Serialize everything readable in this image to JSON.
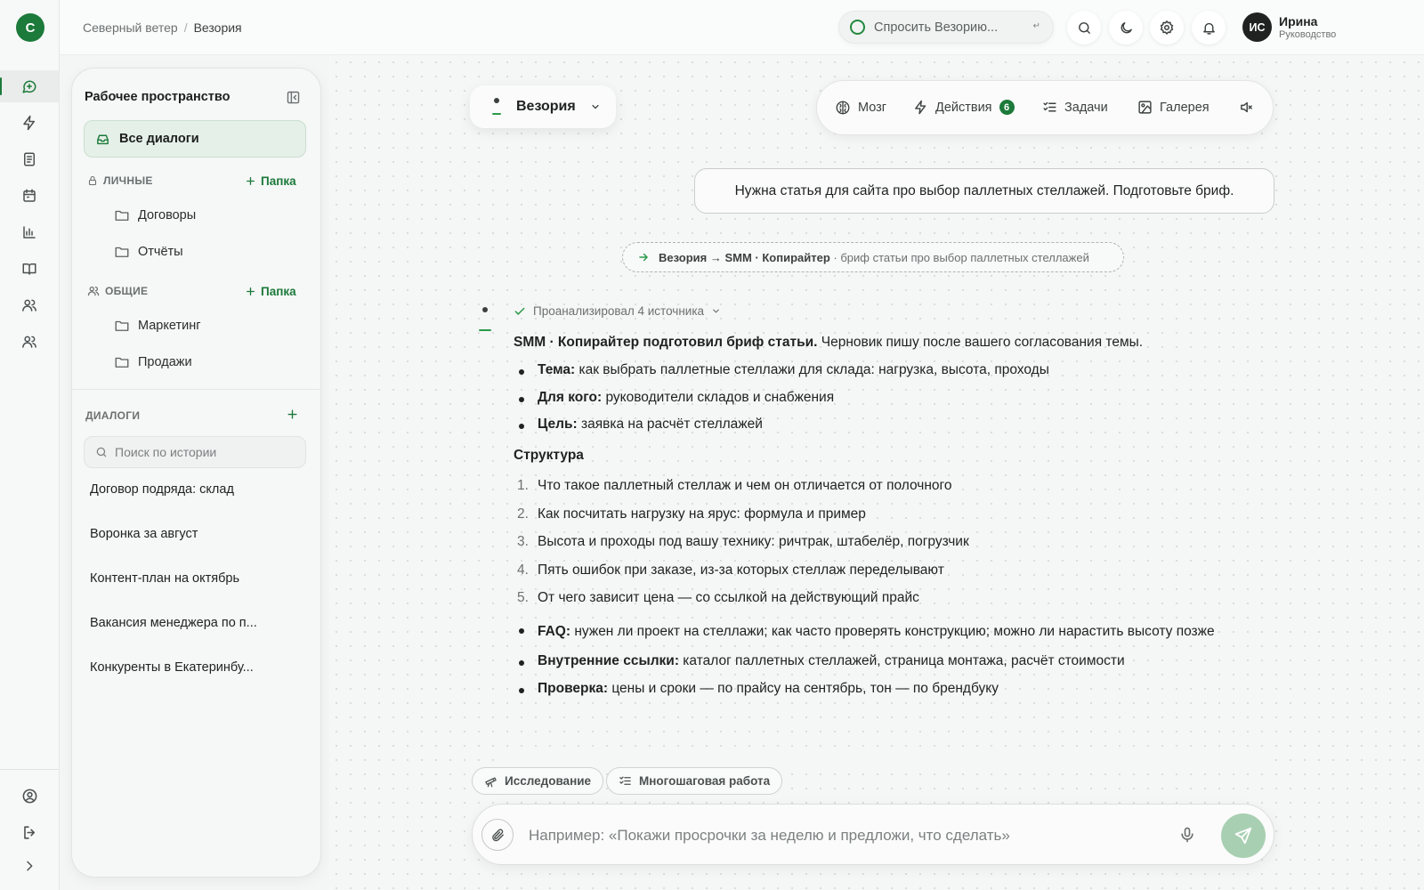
{
  "app": {
    "logo_letter": "С",
    "brand_color": "#1c7a3a"
  },
  "rail": {
    "items": [
      {
        "icon": "chat-icon"
      },
      {
        "icon": "lightning-icon"
      },
      {
        "icon": "document-icon"
      },
      {
        "icon": "calendar-icon"
      },
      {
        "icon": "chart-icon"
      },
      {
        "icon": "book-icon"
      },
      {
        "icon": "team-icon"
      },
      {
        "icon": "users-icon"
      }
    ],
    "bottom": [
      {
        "icon": "profile-icon"
      },
      {
        "icon": "logout-icon"
      },
      {
        "icon": "expand-icon"
      }
    ]
  },
  "topbar": {
    "breadcrumb": [
      "Северный ветер",
      "Везория"
    ],
    "breadcrumb_sep": "/",
    "ask_placeholder": "Спросить Везорию...",
    "ask_kbd": "↵",
    "user": {
      "initials": "ИС",
      "name": "Ирина",
      "role": "Руководство"
    }
  },
  "sidebar": {
    "title": "Рабочее пространство",
    "all_dialogs": "Все диалоги",
    "personal": {
      "label": "ЛИЧНЫЕ",
      "add": "Папка",
      "folders": [
        "Договоры",
        "Отчёты"
      ]
    },
    "shared": {
      "label": "ОБЩИЕ",
      "add": "Папка",
      "folders": [
        "Маркетинг",
        "Продажи"
      ]
    },
    "dialogs_label": "ДИАЛОГИ",
    "search_placeholder": "Поиск по истории",
    "history": [
      "Договор подряда: склад",
      "Воронка за август",
      "Контент-план на октябрь",
      "Вакансия менеджера по п...",
      "Конкуренты в Екатеринбу..."
    ]
  },
  "agent": {
    "name": "Везория"
  },
  "toolbar": {
    "brain": "Мозг",
    "actions": "Действия",
    "actions_count": "6",
    "tasks": "Задачи",
    "gallery": "Галерея"
  },
  "chat": {
    "user_message": "Нужна статья для сайта про выбор паллетных стеллажей. Подготовьте бриф.",
    "route": {
      "from": "Везория",
      "arrow": "→",
      "to": "SMM · Копирайтер",
      "note": "· бриф статьи про выбор паллетных стеллажей"
    },
    "analyzed": "Проанализировал 4 источника",
    "reply": {
      "intro_bold": "SMM · Копирайтер подготовил бриф статьи.",
      "intro_rest": " Черновик пишу после вашего согласования темы.",
      "meta": [
        {
          "label": "Тема:",
          "text": " как выбрать паллетные стеллажи для склада: нагрузка, высота, проходы"
        },
        {
          "label": "Для кого:",
          "text": " руководители складов и снабжения"
        },
        {
          "label": "Цель:",
          "text": " заявка на расчёт стеллажей"
        }
      ],
      "structure_title": "Структура",
      "structure": [
        {
          "n": "1.",
          "text": "Что такое паллетный стеллаж и чем он отличается от полочного"
        },
        {
          "n": "2.",
          "text": "Как посчитать нагрузку на ярус: формула и пример"
        },
        {
          "n": "3.",
          "text": "Высота и проходы под вашу технику: ричтрак, штабелёр, погрузчик"
        },
        {
          "n": "4.",
          "text": "Пять ошибок при заказе, из-за которых стеллаж переделывают"
        },
        {
          "n": "5.",
          "text": "От чего зависит цена — со ссылкой на действующий прайс"
        }
      ],
      "extra": [
        {
          "label": "FAQ:",
          "text": " нужен ли проект на стеллажи; как часто проверять конструкцию; можно ли нарастить высоту позже"
        },
        {
          "label": "Внутренние ссылки:",
          "text": " каталог паллетных стеллажей, страница монтажа, расчёт стоимости"
        },
        {
          "label": "Проверка:",
          "text": " цены и сроки — по прайсу на сентябрь, тон — по брендбуку"
        }
      ]
    }
  },
  "composer": {
    "chips": [
      "Исследование",
      "Многошаговая работа"
    ],
    "placeholder": "Например: «Покажи просрочки за неделю и предложи, что сделать»"
  }
}
